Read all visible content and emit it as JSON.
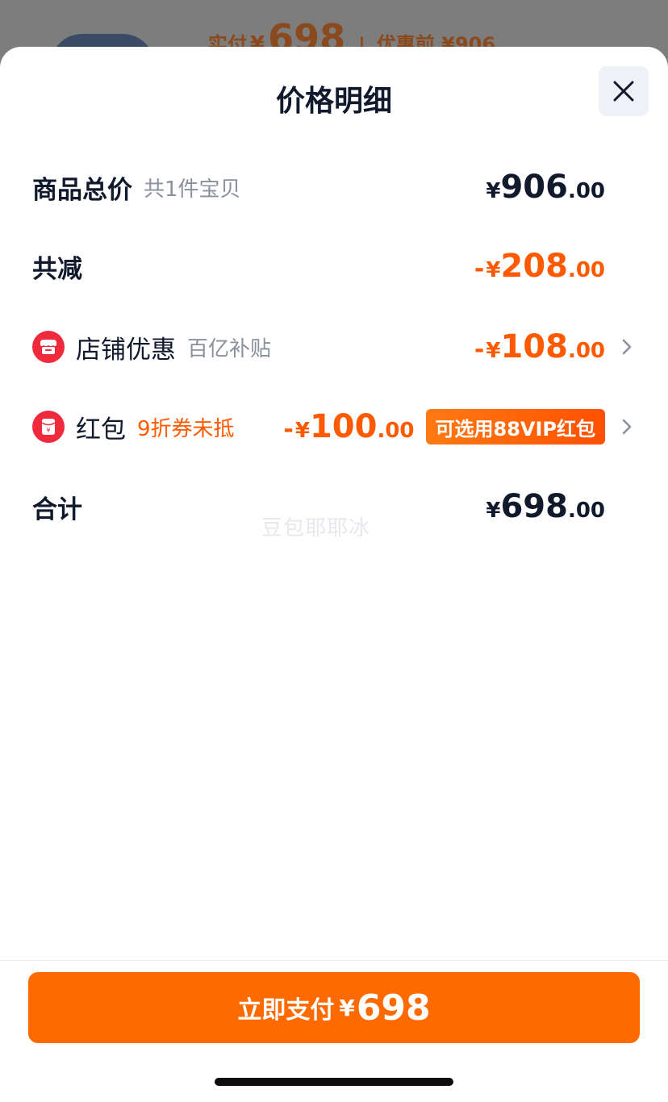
{
  "background": {
    "paid_label": "实付",
    "paid_symbol": "¥",
    "paid_amount": "698",
    "separator": "|",
    "original_text": "优惠前 ¥906"
  },
  "sheet": {
    "title": "价格明细",
    "close_icon": "close-icon"
  },
  "rows": {
    "total": {
      "label": "商品总价",
      "sub": "共1件宝贝",
      "symbol": "¥",
      "integer": "906",
      "decimal": ".00"
    },
    "discount": {
      "label": "共减",
      "minus": "-",
      "symbol": "¥",
      "integer": "208",
      "decimal": ".00"
    },
    "store": {
      "icon": "store-icon",
      "label": "店铺优惠",
      "sub": "百亿补贴",
      "minus": "-",
      "symbol": "¥",
      "integer": "108",
      "decimal": ".00"
    },
    "redpacket": {
      "icon": "red-packet-icon",
      "label": "红包",
      "sub": "9折券未抵",
      "minus": "-",
      "symbol": "¥",
      "integer": "100",
      "decimal": ".00",
      "badge": "可选用88VIP红包"
    },
    "sum": {
      "label": "合计",
      "symbol": "¥",
      "integer": "698",
      "decimal": ".00"
    }
  },
  "watermark": "豆包耶耶冰",
  "pay_button": {
    "label": "立即支付",
    "symbol": "¥",
    "amount": "698"
  },
  "colors": {
    "accent": "#ff6a00",
    "discount_text": "#ff5a00",
    "icon_red": "#f02a3d",
    "text_primary": "#11192d",
    "text_secondary": "#8a909c"
  }
}
